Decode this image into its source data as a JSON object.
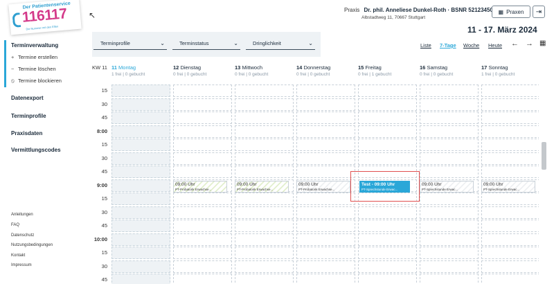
{
  "logo": {
    "line1": "Der Patientenservice",
    "number": "116117",
    "tagline": "Die Nummer mit den Elfen"
  },
  "header": {
    "praxis_label": "Praxis",
    "doctor": "Dr. phil. Anneliese Dunkel-Roth · BSNR 521234500",
    "address": "Albstadtweg 11, 70667 Stuttgart",
    "praxen_button": "Praxen",
    "date_range": "11 - 17. März 2024"
  },
  "sidebar": {
    "main_section": "Terminverwaltung",
    "sub_items": [
      {
        "icon": "plus-icon",
        "glyph": "+",
        "label": "Termine erstellen"
      },
      {
        "icon": "minus-icon",
        "glyph": "−",
        "label": "Termine löschen"
      },
      {
        "icon": "block-icon",
        "glyph": "⦸",
        "label": "Termine blockieren"
      }
    ],
    "sections": [
      "Datenexport",
      "Terminprofile",
      "Praxisdaten",
      "Vermittlungscodes"
    ],
    "footer_links": [
      "Anleitungen",
      "FAQ",
      "Datenschutz",
      "Nutzungsbedingungen",
      "Kontakt",
      "Impressum"
    ]
  },
  "filters": {
    "profile": "Terminprofile",
    "status": "Terminstatus",
    "urgency": "Dringlichkeit"
  },
  "views": {
    "list": "Liste",
    "seven_day": "7-Tage",
    "week": "Woche",
    "today": "Heute",
    "active": "7-Tage"
  },
  "calendar": {
    "week_label": "KW 11",
    "days": [
      {
        "num": "11",
        "name": "Montag",
        "free": "1 frei",
        "booked": "0 gebucht"
      },
      {
        "num": "12",
        "name": "Dienstag",
        "free": "0 frei",
        "booked": "0 gebucht"
      },
      {
        "num": "13",
        "name": "Mittwoch",
        "free": "0 frei",
        "booked": "0 gebucht"
      },
      {
        "num": "14",
        "name": "Donnerstag",
        "free": "0 frei",
        "booked": "0 gebucht"
      },
      {
        "num": "15",
        "name": "Freitag",
        "free": "0 frei",
        "booked": "1 gebucht"
      },
      {
        "num": "16",
        "name": "Samstag",
        "free": "0 frei",
        "booked": "0 gebucht"
      },
      {
        "num": "17",
        "name": "Sonntag",
        "free": "1 frei",
        "booked": "0 gebucht"
      }
    ],
    "times": [
      "15",
      "30",
      "45",
      "8:00",
      "15",
      "30",
      "45",
      "9:00",
      "15",
      "30",
      "45",
      "10:00",
      "15",
      "30",
      "45"
    ],
    "appointments": [
      {
        "day": 1,
        "time": "09:00 Uhr",
        "type": "PT-Probatorik Erwachse...",
        "style": "green"
      },
      {
        "day": 2,
        "time": "09:00 Uhr",
        "type": "PT-Probatorik Erwachse...",
        "style": "green"
      },
      {
        "day": 3,
        "time": "09:00 Uhr",
        "type": "PT-Probatorik Erwachse...",
        "style": "grey"
      },
      {
        "day": 4,
        "time": "Test - 09:00 Uhr",
        "type": "PT-Sprechstunde Erwac...",
        "style": "booked"
      },
      {
        "day": 5,
        "time": "09:00 Uhr",
        "type": "PT-Sprechstunde Erwac...",
        "style": "grey"
      },
      {
        "day": 6,
        "time": "09:00 Uhr",
        "type": "PT-Sprechstunde Erwac...",
        "style": "grey"
      }
    ]
  },
  "colors": {
    "accent": "#2aa7d8",
    "logo_pink": "#d43a8a",
    "highlight": "#e05050"
  }
}
